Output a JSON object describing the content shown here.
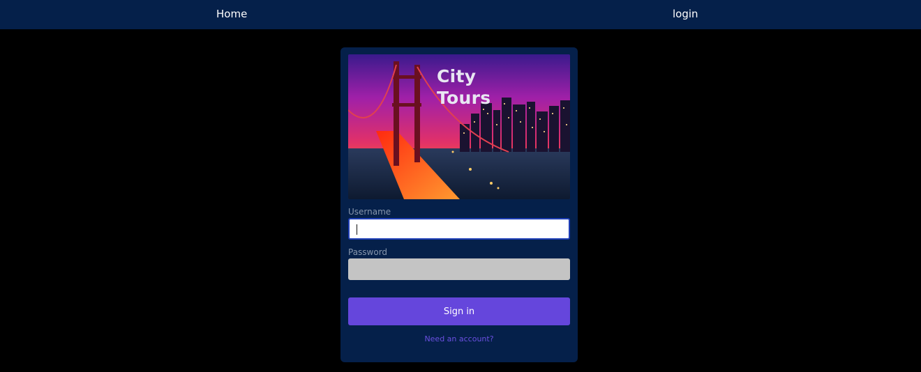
{
  "nav": {
    "home_label": "Home",
    "login_label": "login"
  },
  "hero": {
    "title_line1": "City",
    "title_line2": "Tours"
  },
  "form": {
    "username_label": "Username",
    "username_value": "",
    "password_label": "Password",
    "password_value": "",
    "signin_label": "Sign in",
    "signup_link": "Need an account?"
  },
  "colors": {
    "nav_background": "#05204a",
    "card_background": "#05204a",
    "page_background": "#000000",
    "button_accent": "#6546dc",
    "focus_border": "#1f3fb7",
    "link_color": "#6a4fe0"
  }
}
